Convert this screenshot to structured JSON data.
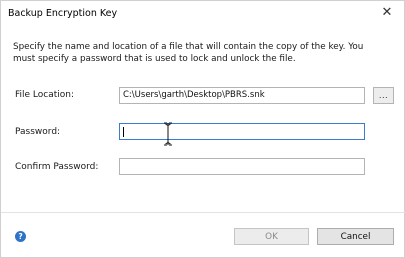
{
  "dialog": {
    "title": "Backup Encryption Key",
    "close_glyph": "✕",
    "description_line1": "Specify the name and location of a file that will contain the copy of the key.  You",
    "description_line2": "must specify a password that is used to lock and unlock the file."
  },
  "form": {
    "file_location_label": "File Location:",
    "file_location_value": "C:\\Users\\garth\\Desktop\\PBRS.snk",
    "browse_label": "...",
    "password_label": "Password:",
    "password_value": "",
    "confirm_password_label": "Confirm Password:",
    "confirm_password_value": ""
  },
  "footer": {
    "help_glyph": "?",
    "ok_label": "OK",
    "cancel_label": "Cancel"
  },
  "icons": {
    "close": "close-icon",
    "help": "help-icon",
    "cursor": "text-cursor-icon"
  },
  "colors": {
    "focus_border": "#3b7bd1",
    "help_icon": "#2f73c9"
  }
}
